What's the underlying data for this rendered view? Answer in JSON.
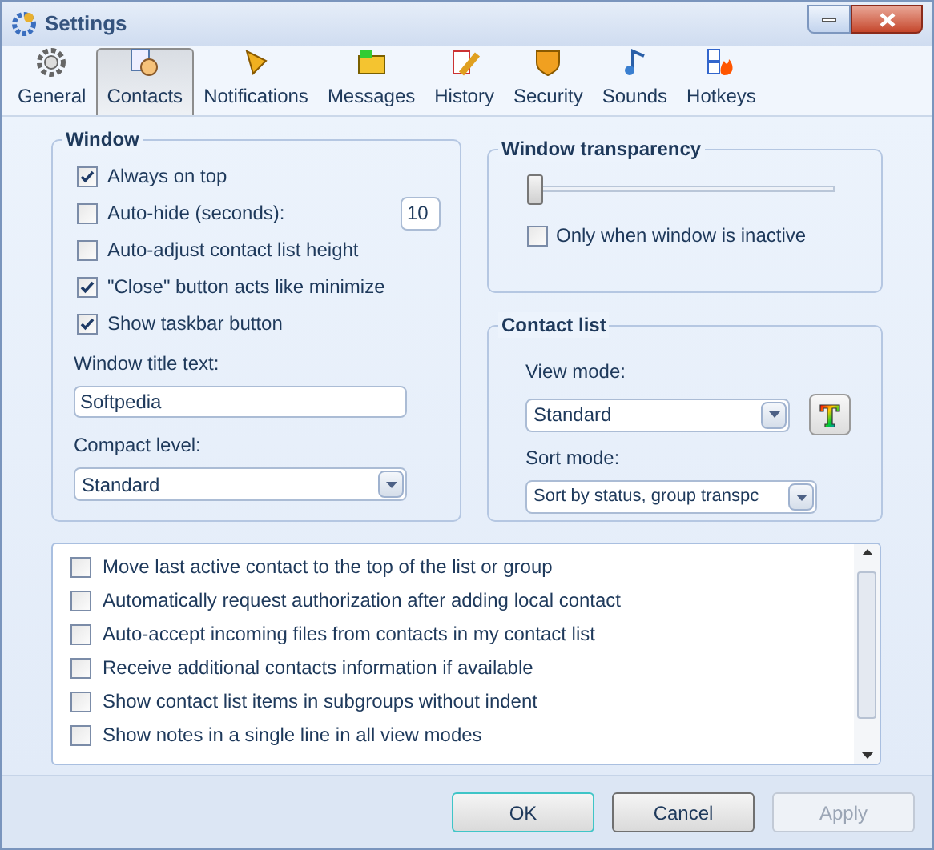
{
  "window": {
    "title": "Settings"
  },
  "tabs": [
    {
      "label": "General",
      "selected": false
    },
    {
      "label": "Contacts",
      "selected": true
    },
    {
      "label": "Notifications",
      "selected": false
    },
    {
      "label": "Messages",
      "selected": false
    },
    {
      "label": "History",
      "selected": false
    },
    {
      "label": "Security",
      "selected": false
    },
    {
      "label": "Sounds",
      "selected": false
    },
    {
      "label": "Hotkeys",
      "selected": false
    }
  ],
  "window_group": {
    "title": "Window",
    "options": [
      {
        "label": "Always on top",
        "checked": true
      },
      {
        "label": "Auto-hide (seconds):",
        "checked": false,
        "value": "10"
      },
      {
        "label": "Auto-adjust contact list height",
        "checked": false
      },
      {
        "label": "\"Close\" button acts like minimize",
        "checked": true
      },
      {
        "label": "Show taskbar button",
        "checked": true
      }
    ],
    "title_text": {
      "label": "Window title text:",
      "value": "Softpedia"
    },
    "compact_level": {
      "label": "Compact level:",
      "value": "Standard"
    }
  },
  "transparency_group": {
    "title": "Window transparency",
    "level": 0,
    "inactive_only": {
      "label": "Only when window is inactive",
      "checked": false
    }
  },
  "contact_list_group": {
    "title": "Contact list",
    "view_mode": {
      "label": "View mode:",
      "value": "Standard"
    },
    "sort_mode": {
      "label": "Sort mode:",
      "value": "Sort by status, group transpc"
    }
  },
  "options_list": [
    {
      "label": "Move last active contact to the top of the list or group",
      "checked": false
    },
    {
      "label": "Automatically request authorization after adding local contact",
      "checked": false
    },
    {
      "label": "Auto-accept incoming files from contacts in my contact list",
      "checked": false
    },
    {
      "label": "Receive additional contacts information if available",
      "checked": false
    },
    {
      "label": "Show contact list items in subgroups without indent",
      "checked": false
    },
    {
      "label": "Show notes in a single line in all view modes",
      "checked": false
    }
  ],
  "buttons": [
    {
      "label": "OK",
      "kind": "default",
      "disabled": false
    },
    {
      "label": "Cancel",
      "kind": "normal",
      "disabled": false
    },
    {
      "label": "Apply",
      "kind": "normal",
      "disabled": true
    }
  ]
}
